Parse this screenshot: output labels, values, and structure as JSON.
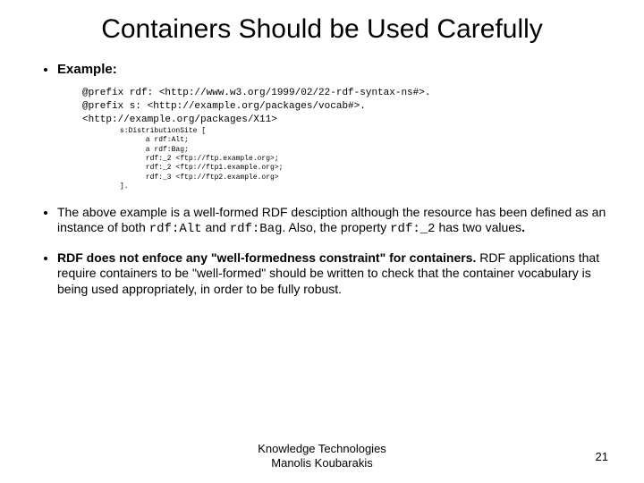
{
  "title": "Containers Should be Used Carefully",
  "bullets": {
    "example_label": "Example:",
    "code_block1": "@prefix rdf: <http://www.w3.org/1999/02/22-rdf-syntax-ns#>.\n@prefix s: <http://example.org/packages/vocab#>.\n<http://example.org/packages/X11>",
    "code_block2": "s:DistributionSite [\n      a rdf:Alt;\n      a rdf:Bag;\n      rdf:_2 <ftp://ftp.example.org>;\n      rdf:_2 <ftp://ftp1.example.org>;\n      rdf:_3 <ftp://ftp2.example.org>\n].",
    "para1_a": "The above example is a well-formed RDF desciption although the resource has been defined as an instance of both ",
    "para1_code1": "rdf:Alt",
    "para1_b": " and ",
    "para1_code2": "rdf:Bag",
    "para1_c": ". Also, the property ",
    "para1_code3": "rdf:_2",
    "para1_d": " has two values",
    "para1_e": ".",
    "para2_a": "RDF does not enfoce any \"well-formedness constraint\" for containers.",
    "para2_b": " RDF applications that require containers to be \"well-formed\" should be written to check that the container vocabulary is being used appropriately, in order to be fully robust."
  },
  "footer_line1": "Knowledge Technologies",
  "footer_line2": "Manolis Koubarakis",
  "page_number": "21"
}
